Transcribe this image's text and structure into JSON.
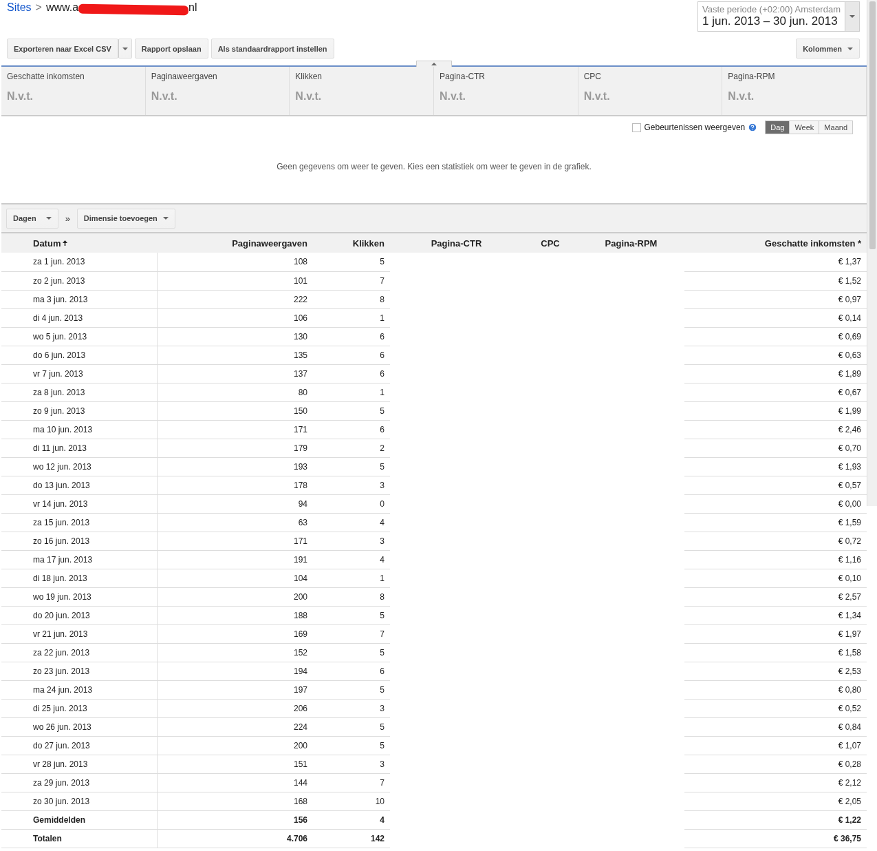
{
  "breadcrumb": {
    "link": "Sites",
    "separator": ">",
    "site_prefix": "www.a",
    "site_suffix": "nl"
  },
  "date_range": {
    "label": "Vaste periode (+02:00) Amsterdam",
    "value": "1 jun. 2013 – 30 jun. 2013"
  },
  "toolbar": {
    "buttons": [
      {
        "label": "Exporteren naar Excel CSV",
        "kind": "split"
      },
      {
        "label": "Rapport opslaan",
        "kind": "plain"
      },
      {
        "label": "Als standaardrapport instellen",
        "kind": "plain"
      }
    ],
    "columns_button": "Kolommen"
  },
  "scorecards": [
    {
      "label": "Geschatte inkomsten",
      "value": "N.v.t."
    },
    {
      "label": "Paginaweergaven",
      "value": "N.v.t."
    },
    {
      "label": "Klikken",
      "value": "N.v.t."
    },
    {
      "label": "Pagina-CTR",
      "value": "N.v.t."
    },
    {
      "label": "CPC",
      "value": "N.v.t."
    },
    {
      "label": "Pagina-RPM",
      "value": "N.v.t."
    }
  ],
  "chart": {
    "events": {
      "label": "Gebeurtenissen weergeven",
      "checked": false
    },
    "periods": [
      {
        "label": "Dag",
        "selected": true
      },
      {
        "label": "Week",
        "selected": false
      },
      {
        "label": "Maand",
        "selected": false
      }
    ],
    "empty_message": "Geen gegevens om weer te geven. Kies een statistiek om weer te geven in de grafiek."
  },
  "dimensions": {
    "primary": "Dagen",
    "separator": "»",
    "add": "Dimensie toevoegen"
  },
  "table": {
    "columns": [
      "Datum",
      "Paginaweergaven",
      "Klikken",
      "Pagina-CTR",
      "CPC",
      "Pagina-RPM",
      "Geschatte inkomsten *"
    ],
    "rows": [
      [
        "za 1 jun. 2013",
        "108",
        "5",
        "€ 1,37"
      ],
      [
        "zo 2 jun. 2013",
        "101",
        "7",
        "€ 1,52"
      ],
      [
        "ma 3 jun. 2013",
        "222",
        "8",
        "€ 0,97"
      ],
      [
        "di 4 jun. 2013",
        "106",
        "1",
        "€ 0,14"
      ],
      [
        "wo 5 jun. 2013",
        "130",
        "6",
        "€ 0,69"
      ],
      [
        "do 6 jun. 2013",
        "135",
        "6",
        "€ 0,63"
      ],
      [
        "vr 7 jun. 2013",
        "137",
        "6",
        "€ 1,89"
      ],
      [
        "za 8 jun. 2013",
        "80",
        "1",
        "€ 0,67"
      ],
      [
        "zo 9 jun. 2013",
        "150",
        "5",
        "€ 1,99"
      ],
      [
        "ma 10 jun. 2013",
        "171",
        "6",
        "€ 2,46"
      ],
      [
        "di 11 jun. 2013",
        "179",
        "2",
        "€ 0,70"
      ],
      [
        "wo 12 jun. 2013",
        "193",
        "5",
        "€ 1,93"
      ],
      [
        "do 13 jun. 2013",
        "178",
        "3",
        "€ 0,57"
      ],
      [
        "vr 14 jun. 2013",
        "94",
        "0",
        "€ 0,00"
      ],
      [
        "za 15 jun. 2013",
        "63",
        "4",
        "€ 1,59"
      ],
      [
        "zo 16 jun. 2013",
        "171",
        "3",
        "€ 0,72"
      ],
      [
        "ma 17 jun. 2013",
        "191",
        "4",
        "€ 1,16"
      ],
      [
        "di 18 jun. 2013",
        "104",
        "1",
        "€ 0,10"
      ],
      [
        "wo 19 jun. 2013",
        "200",
        "8",
        "€ 2,57"
      ],
      [
        "do 20 jun. 2013",
        "188",
        "5",
        "€ 1,34"
      ],
      [
        "vr 21 jun. 2013",
        "169",
        "7",
        "€ 1,97"
      ],
      [
        "za 22 jun. 2013",
        "152",
        "5",
        "€ 1,58"
      ],
      [
        "zo 23 jun. 2013",
        "194",
        "6",
        "€ 2,53"
      ],
      [
        "ma 24 jun. 2013",
        "197",
        "5",
        "€ 0,80"
      ],
      [
        "di 25 jun. 2013",
        "206",
        "3",
        "€ 0,52"
      ],
      [
        "wo 26 jun. 2013",
        "224",
        "5",
        "€ 0,84"
      ],
      [
        "do 27 jun. 2013",
        "200",
        "5",
        "€ 1,07"
      ],
      [
        "vr 28 jun. 2013",
        "151",
        "3",
        "€ 0,28"
      ],
      [
        "za 29 jun. 2013",
        "144",
        "7",
        "€ 2,12"
      ],
      [
        "zo 30 jun. 2013",
        "168",
        "10",
        "€ 2,05"
      ]
    ],
    "summary": [
      [
        "Gemiddelden",
        "156",
        "4",
        "€ 1,22"
      ],
      [
        "Totalen",
        "4.706",
        "142",
        "€ 36,75"
      ]
    ]
  }
}
